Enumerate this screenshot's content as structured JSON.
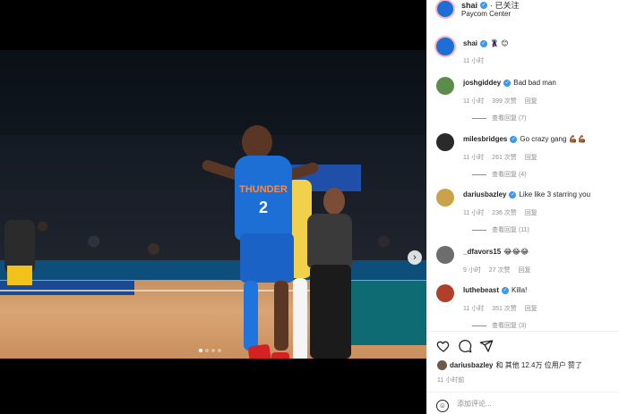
{
  "post": {
    "author": "shai",
    "follow_status": "· 已关注",
    "location": "Paycom Center",
    "caption_emojis": "🦹 😊",
    "caption_time": "11 小时",
    "jersey_text": "THUNDER",
    "jersey_number": "2"
  },
  "comments": [
    {
      "user": "joshgiddey",
      "text": "Bad bad man",
      "time": "11 小时",
      "likes": "399 次赞",
      "reply": "回复",
      "view_replies": "查看回复 (7)",
      "avatar_color": "#5b8c4a"
    },
    {
      "user": "milesbridges",
      "text": "Go crazy gang 💪🏾💪🏾",
      "time": "11 小时",
      "likes": "261 次赞",
      "reply": "回复",
      "view_replies": "查看回复 (4)",
      "avatar_color": "#2a2a2a"
    },
    {
      "user": "dariusbazley",
      "text": "Like like 3 starring you",
      "time": "11 小时",
      "likes": "236 次赞",
      "reply": "回复",
      "view_replies": "查看回复 (11)",
      "avatar_color": "#c9a24a"
    },
    {
      "user": "_dfavors15",
      "text": "😂😂😂",
      "time": "9 小时",
      "likes": "27 次赞",
      "reply": "回复",
      "view_replies": "",
      "avatar_color": "#6d6d6d"
    },
    {
      "user": "luthebeast",
      "text": "Killa!",
      "time": "11 小时",
      "likes": "351 次赞",
      "reply": "回复",
      "view_replies": "查看回复 (3)",
      "avatar_color": "#b0402a"
    }
  ],
  "likes_summary": {
    "user": "dariusbazley",
    "rest": "和 其他 12.4万 位用户 赞了"
  },
  "post_time": "11 小时前",
  "comment_box": {
    "placeholder": "添加评论..."
  },
  "icons": [
    "heart-icon",
    "comment-icon",
    "share-icon",
    "emoji-icon",
    "next-arrow-icon",
    "verified-icon"
  ]
}
